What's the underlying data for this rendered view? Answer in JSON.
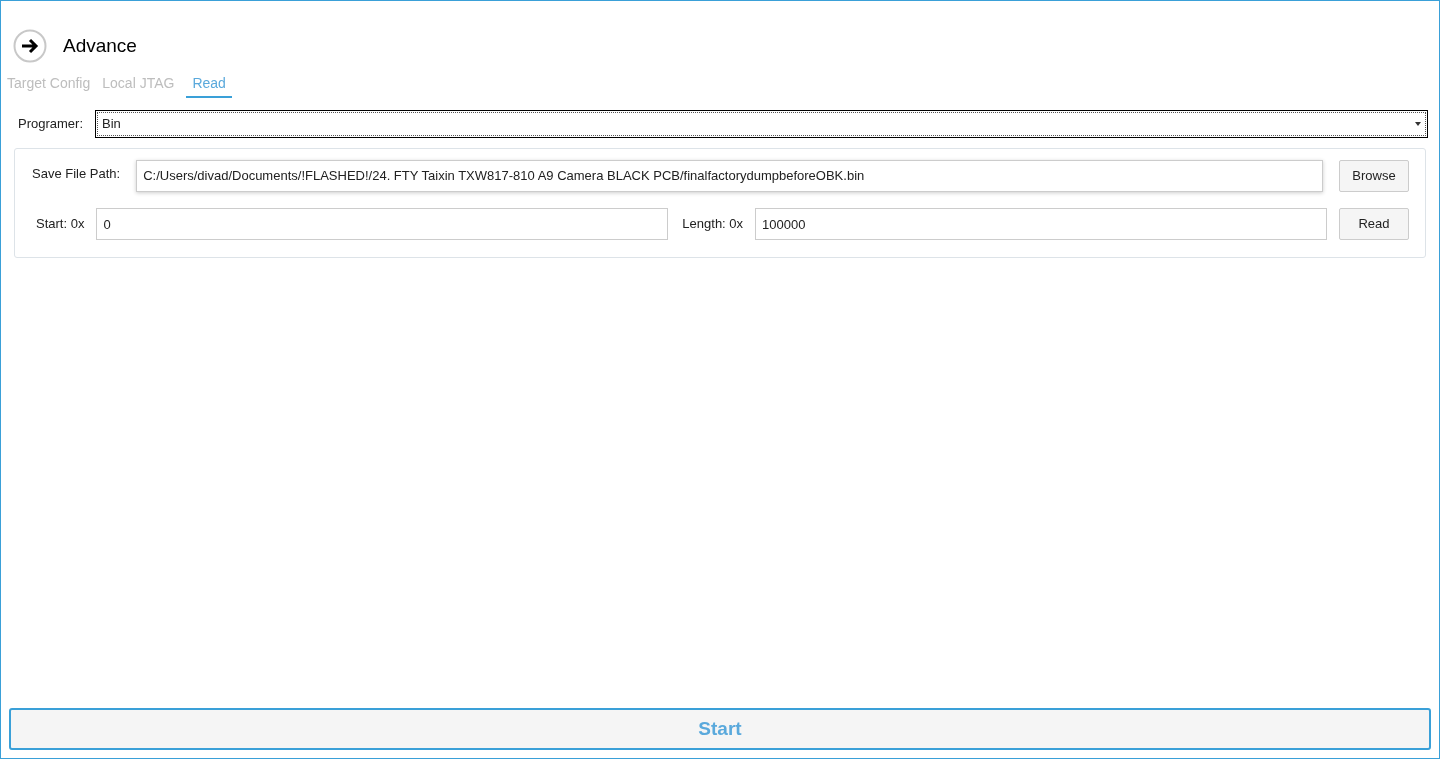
{
  "header": {
    "title": "Advance"
  },
  "tabs": [
    {
      "label": "Target Config",
      "selected": false
    },
    {
      "label": "Local JTAG",
      "selected": false
    },
    {
      "label": "Read",
      "selected": true
    }
  ],
  "programmer": {
    "label": "Programer:",
    "value": "Bin"
  },
  "save_path": {
    "label": "Save File Path:",
    "value": "C:/Users/divad/Documents/!FLASHED!/24. FTY Taixin TXW817-810 A9 Camera BLACK PCB/finalfactorydumpbeforeOBK.bin",
    "button": "Browse"
  },
  "start": {
    "label": "Start: 0x",
    "value": "0"
  },
  "length": {
    "label": "Length: 0x",
    "value": "100000",
    "button": "Read"
  },
  "start_button": "Start"
}
